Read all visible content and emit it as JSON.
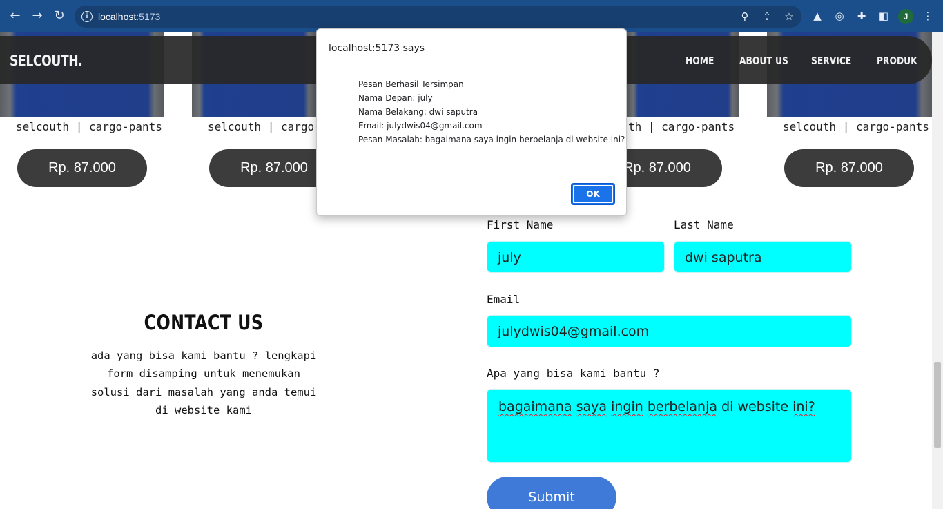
{
  "browser": {
    "url_host": "localhost",
    "url_port": ":5173",
    "profile_initial": "J"
  },
  "navbar": {
    "brand": "SELCOUTH.",
    "links": [
      "HOME",
      "ABOUT US",
      "SERVICE",
      "PRODUK"
    ]
  },
  "products": [
    {
      "name": "selcouth | cargo-pants",
      "price": "Rp. 87.000"
    },
    {
      "name": "selcouth | cargo-p",
      "price": "Rp. 87.000"
    },
    {
      "name": "th | cargo-pants",
      "price": "Rp. 87.000"
    },
    {
      "name": "selcouth | cargo-pants",
      "price": "Rp. 87.000"
    }
  ],
  "contact": {
    "title": "CONTACT US",
    "description": "ada yang bisa kami bantu ? lengkapi form disamping untuk menemukan solusi dari masalah yang anda temui di website kami"
  },
  "form": {
    "first_name_label": "First Name",
    "first_name_value": "july",
    "last_name_label": "Last Name",
    "last_name_value": "dwi saputra",
    "email_label": "Email",
    "email_value": "julydwis04@gmail.com",
    "message_label": "Apa yang bisa kami bantu ?",
    "message_words": [
      "bagaimana",
      "saya",
      "ingin",
      "berbelanja",
      "di website",
      "ini?"
    ],
    "submit_label": "Submit"
  },
  "alert": {
    "origin": "localhost:5173 says",
    "lines": [
      "Pesan Berhasil Tersimpan",
      "Nama Depan: july",
      "Nama Belakang: dwi saputra",
      "Email: julydwis04@gmail.com",
      "Pesan Masalah: bagaimana saya ingin berbelanja di website ini?"
    ],
    "ok_label": "OK"
  },
  "colors": {
    "browser_frame": "#1b4f8c",
    "field_background": "#00ffff",
    "submit_button": "#3f7ad9",
    "price_pill": "#3c3c3c",
    "dialog_button": "#1a73e8"
  }
}
